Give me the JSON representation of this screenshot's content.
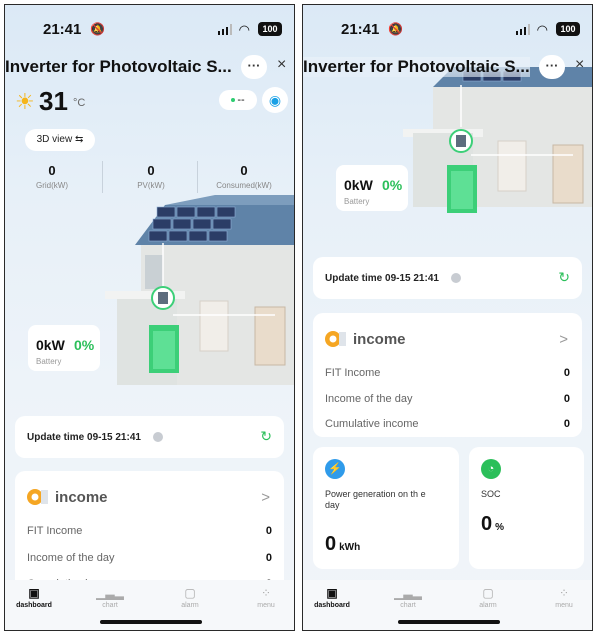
{
  "status_bar": {
    "time": "21:41",
    "battery": "100"
  },
  "header": {
    "title_left": "Inverter for Photovoltaic S...",
    "title_right": "Inverter for Photovoltaic S...",
    "more": "···",
    "close": "×"
  },
  "weather": {
    "temp": "31",
    "unit": "°C"
  },
  "connection_pill": "--",
  "view_button": "3D view ⇆",
  "stats": [
    {
      "value": "0",
      "label": "Grid(kW)"
    },
    {
      "value": "0",
      "label": "PV(kW)"
    },
    {
      "value": "0",
      "label": "Consumed(kW)"
    }
  ],
  "battery": {
    "power": "0kW",
    "percent": "0%",
    "label": "Battery"
  },
  "update": {
    "text": "Update time 09-15 21:41"
  },
  "income": {
    "title": "income",
    "chevron": ">",
    "rows": [
      {
        "label": "FIT Income",
        "value": "0"
      },
      {
        "label": "Income of the day",
        "value": "0"
      },
      {
        "label": "Cumulative income",
        "value": "0"
      }
    ]
  },
  "power_card": {
    "label": "Power generation on th e day",
    "value": "0",
    "unit": "kWh"
  },
  "soc_card": {
    "label": "SOC",
    "value": "0",
    "unit": "%"
  },
  "nav": [
    {
      "label": "dashboard",
      "icon": "dashboard-icon"
    },
    {
      "label": "chart",
      "icon": "chart-icon"
    },
    {
      "label": "alarm",
      "icon": "alarm-icon"
    },
    {
      "label": "menu",
      "icon": "menu-icon"
    }
  ],
  "colors": {
    "accent_green": "#2bbf5a",
    "wifi_blue": "#18a0e6",
    "sun_yellow": "#f5b51a"
  }
}
